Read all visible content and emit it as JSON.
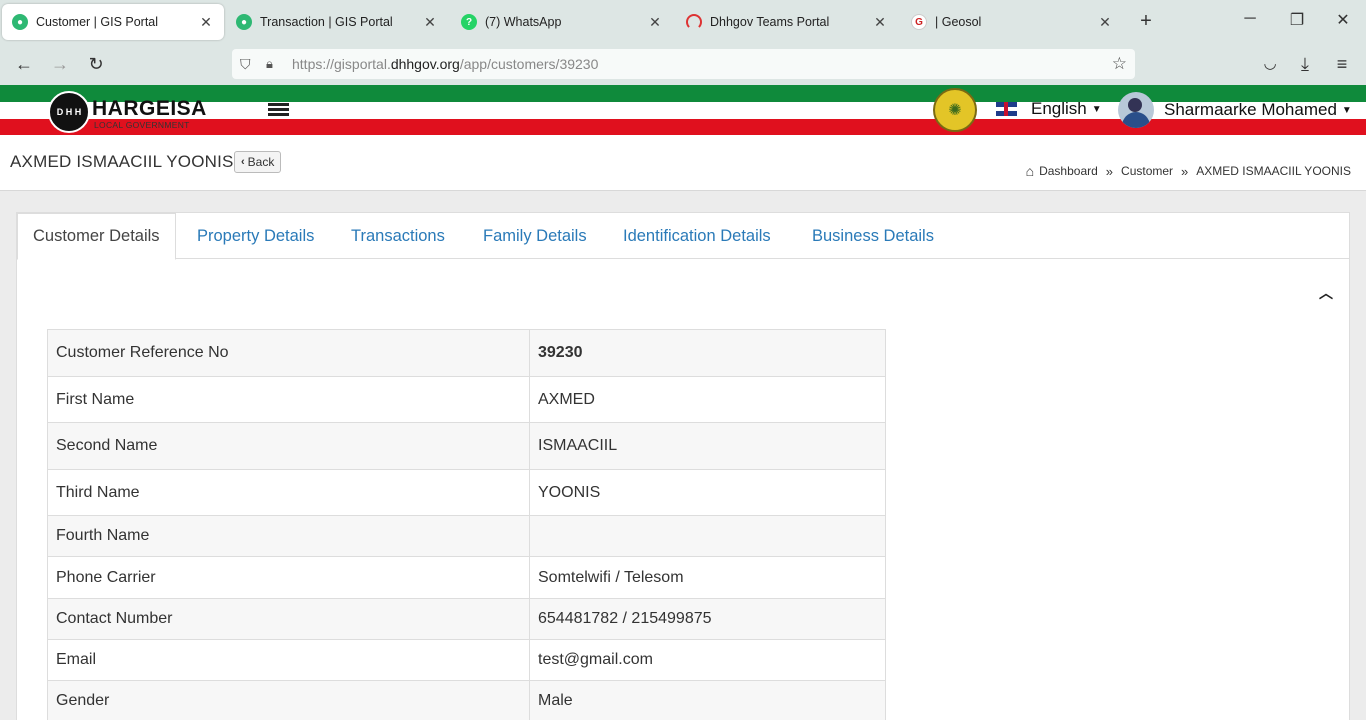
{
  "browser": {
    "tabs": [
      {
        "title": "Customer | GIS Portal",
        "favicon": "gis-icon",
        "active": true
      },
      {
        "title": "Transaction | GIS Portal",
        "favicon": "gis-icon",
        "active": false
      },
      {
        "title": "(7) WhatsApp",
        "favicon": "whatsapp-icon",
        "active": false
      },
      {
        "title": "Dhhgov Teams Portal",
        "favicon": "teams-icon",
        "active": false
      },
      {
        "title": "| Geosol",
        "favicon": "geosol-icon",
        "active": false
      }
    ],
    "url": {
      "prefix": "https://gisportal.",
      "host": "dhhgov.org",
      "path": "/app/customers/39230"
    }
  },
  "header": {
    "logo_initials": "D H H",
    "logo_title": "HARGEISA",
    "logo_subtitle": "LOCAL GOVERNMENT",
    "language": "English",
    "user_name": "Sharmaarke Mohamed"
  },
  "page": {
    "title": "AXMED ISMAACIIL YOONIS",
    "back_label": "Back",
    "breadcrumb": [
      "Dashboard",
      "Customer",
      "AXMED ISMAACIIL YOONIS"
    ]
  },
  "content_tabs": [
    "Customer Details",
    "Property Details",
    "Transactions",
    "Family Details",
    "Identification Details",
    "Business Details"
  ],
  "details": [
    {
      "label": "Customer Reference No",
      "value": "39230"
    },
    {
      "label": "First Name",
      "value": "AXMED"
    },
    {
      "label": "Second Name",
      "value": "ISMAACIIL"
    },
    {
      "label": "Third Name",
      "value": "YOONIS"
    },
    {
      "label": "Fourth Name",
      "value": ""
    },
    {
      "label": "Phone Carrier",
      "value": "Somtelwifi / Telesom"
    },
    {
      "label": "Contact Number",
      "value": "654481782 / 215499875"
    },
    {
      "label": "Email",
      "value": "test@gmail.com"
    },
    {
      "label": "Gender",
      "value": "Male"
    }
  ],
  "colors": {
    "green_stripe": "#0f8a3b",
    "red_stripe": "#e0101e",
    "link": "#2a7ab8"
  }
}
